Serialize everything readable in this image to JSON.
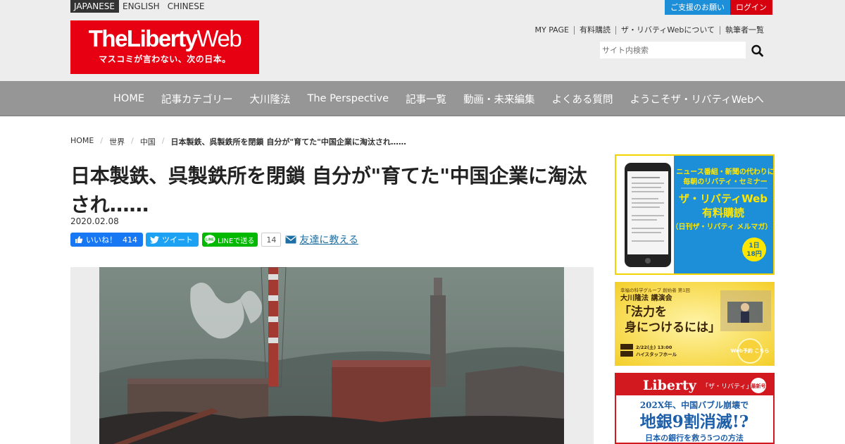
{
  "languages": {
    "japanese": "JAPANESE",
    "english": "ENGLISH",
    "chinese": "CHINESE"
  },
  "header_buttons": {
    "support": "ご支援のお願い",
    "login": "ログイン"
  },
  "logo": {
    "main_bold": "TheLiberty",
    "main_light": "Web",
    "tagline": "マスコミが言わない、次の日本。"
  },
  "utility_links": [
    "MY PAGE",
    "有料購読",
    "ザ・リバティWebについて",
    "執筆者一覧"
  ],
  "search": {
    "placeholder": "サイト内検索"
  },
  "nav": [
    "HOME",
    "記事カテゴリー",
    "大川隆法",
    "The Perspective",
    "記事一覧",
    "動画・未来編集",
    "よくある質問",
    "ようこそザ・リバティWebへ"
  ],
  "breadcrumb": {
    "home": "HOME",
    "level1": "世界",
    "level2": "中国",
    "current": "日本製鉄、呉製鉄所を閉鎖 自分が\"育てた\"中国企業に淘汰され……"
  },
  "article": {
    "title": "日本製鉄、呉製鉄所を閉鎖 自分が\"育てた\"中国企業に淘汰され……",
    "date": "2020.02.08"
  },
  "share": {
    "like_label": "いいね！",
    "like_count": "414",
    "tweet_label": "ツイート",
    "line_label": "LINEで送る",
    "line_count": "14",
    "tell_friend": "友達に教える"
  },
  "sidebar": {
    "ad1": {
      "headline1": "ニュース番組・新聞の代わりに",
      "headline2": "毎朝のリバティ・セミナー",
      "title1": "ザ・リバティWeb",
      "title2": "有料購読",
      "sub": "（日刊ザ・リバティ メルマガ）",
      "badge1": "1日",
      "badge2": "18円"
    },
    "ad2": {
      "org": "幸福の科学グループ 創始者 第1回",
      "speaker": "大川隆法 講演会",
      "title1": "「法力を",
      "title2": "身につけるには」",
      "date": "2/22(土) 13:00",
      "venue": "ハイスタッフホール",
      "cta": "Web予約 こちら"
    },
    "ad3": {
      "brand": "Liberty",
      "brand_sub": "「ザ・リバティ」",
      "tag": "最新号",
      "line1": "202X年、中国バブル崩壊で",
      "line2": "地銀9割消滅!?",
      "line3": "日本の銀行を救う5つの方法"
    }
  },
  "colors": {
    "brand_red": "#e60012",
    "nav_gray": "#969696",
    "facebook": "#1877f2",
    "twitter": "#1da1f2",
    "line": "#00b900",
    "accent_blue": "#1d8fd8"
  }
}
